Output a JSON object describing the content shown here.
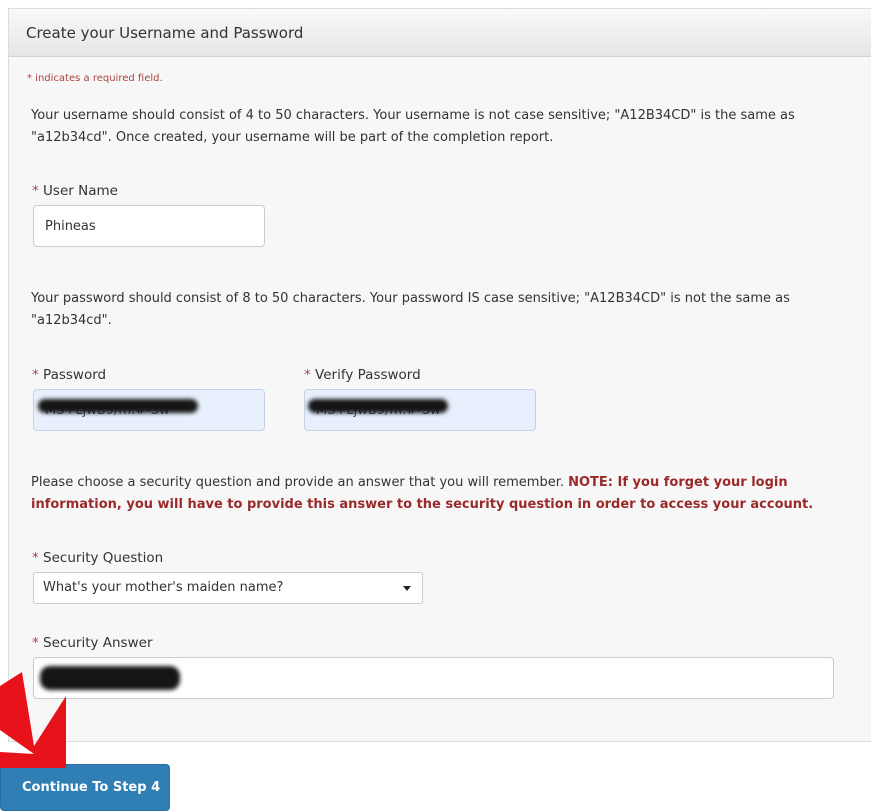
{
  "header": {
    "title": "Create your Username and Password"
  },
  "required_note": {
    "star": "*",
    "text": " indicates a required field."
  },
  "username_help": "Your username should consist of 4 to 50 characters. Your username is not case sensitive; \"A12B34CD\" is the same as \"a12b34cd\". Once created, your username will be part of the completion report.",
  "password_help": "Your password should consist of 8 to 50 characters. Your password IS case sensitive; \"A12B34CD\" is not the same as \"a12b34cd\".",
  "security_help": {
    "text": "Please choose a security question and provide an answer that you will remember. ",
    "warning": "NOTE: If you forget your login information, you will have to provide this answer to the security question in order to access your account."
  },
  "fields": {
    "username": {
      "star": "*",
      "label": " User Name",
      "value": "Phineas"
    },
    "password": {
      "star": "*",
      "label": " Password",
      "value": "MS+LjwB9/m.#-Sw"
    },
    "verify_password": {
      "star": "*",
      "label": " Verify Password",
      "value": "MS+LjwB9/m.#-Sw"
    },
    "security_question": {
      "star": "*",
      "label": " Security Question",
      "selected": "What's your mother's maiden name?"
    },
    "security_answer": {
      "star": "*",
      "label": " Security Answer",
      "value": "Y"
    }
  },
  "continue_button": {
    "label": "Continue To Step 4"
  },
  "colors": {
    "required": "#a94442",
    "warning": "#9a2a2a",
    "button": "#2f7fb5",
    "annotation_arrow": "#e8131a"
  }
}
